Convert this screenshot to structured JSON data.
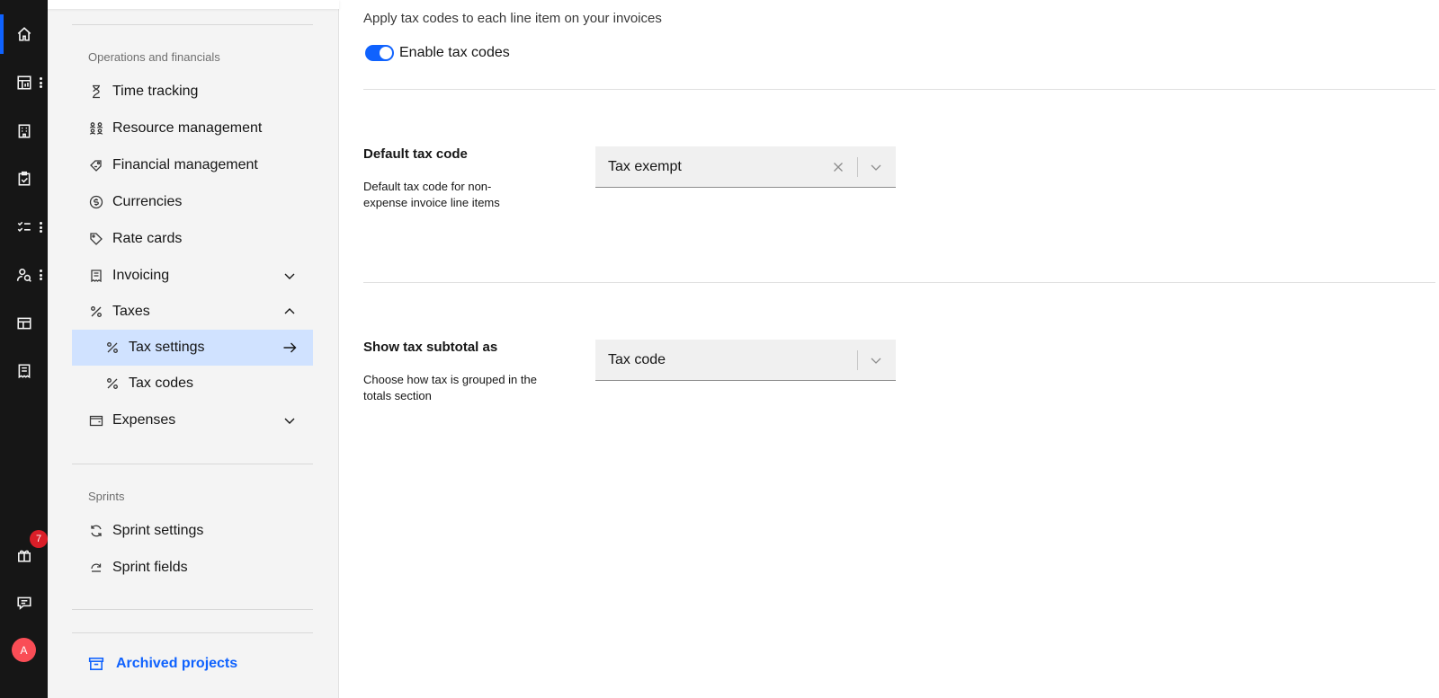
{
  "rail": {
    "badge_count": "7",
    "avatar_initial": "A",
    "items": [
      "home-icon",
      "dashboard-icon",
      "building-icon",
      "clipboard-icon",
      "task-list-icon",
      "people-icon",
      "layout-icon",
      "receipt-icon"
    ]
  },
  "sidebar": {
    "section_ops_label": "Operations and financials",
    "items": {
      "time_tracking": "Time tracking",
      "resource_management": "Resource management",
      "financial_management": "Financial management",
      "currencies": "Currencies",
      "rate_cards": "Rate cards",
      "invoicing": "Invoicing",
      "taxes": "Taxes",
      "tax_settings": "Tax settings",
      "tax_codes": "Tax codes",
      "expenses": "Expenses"
    },
    "section_sprints_label": "Sprints",
    "sprint_items": {
      "sprint_settings": "Sprint settings",
      "sprint_fields": "Sprint fields"
    },
    "archived_label": "Archived projects"
  },
  "main": {
    "intro": "Apply tax codes to each line item on your invoices",
    "toggle_label": "Enable tax codes",
    "toggle_on": true,
    "default_tax": {
      "title": "Default tax code",
      "description": "Default tax code for non-expense invoice line items",
      "value": "Tax exempt"
    },
    "subtotal": {
      "title": "Show tax subtotal as",
      "description": "Choose how tax is grouped in the totals section",
      "value": "Tax code"
    }
  },
  "colors": {
    "accent": "#0f62fe",
    "active_bg": "#d0e2ff",
    "rail_bg": "#161616",
    "badge": "#da1e28"
  }
}
